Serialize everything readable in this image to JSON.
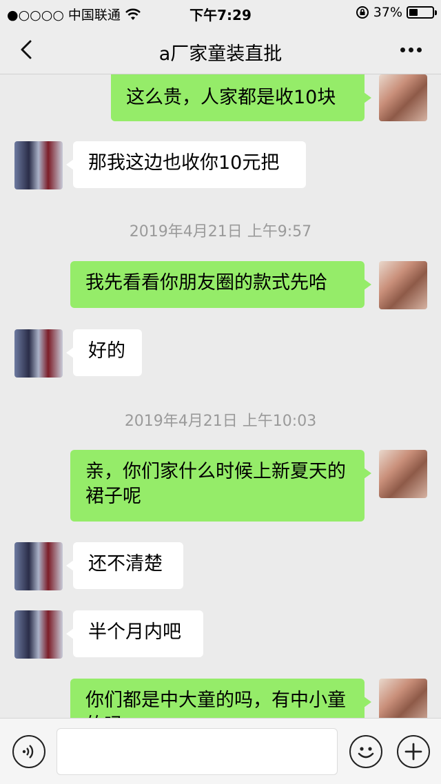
{
  "status_bar": {
    "carrier": "●○○○○ 中国联通",
    "time": "下午7:29",
    "battery": "37%",
    "battery_level": 0.37
  },
  "nav": {
    "title": "a厂家童装直批"
  },
  "messages": [
    {
      "type": "me",
      "text": "这么贵，人家都是收10块"
    },
    {
      "type": "them",
      "text": "那我这边也收你10元把"
    },
    {
      "type": "time",
      "text": "2019年4月21日 上午9:57"
    },
    {
      "type": "me",
      "text": "我先看看你朋友圈的款式先哈"
    },
    {
      "type": "them",
      "text": "好的"
    },
    {
      "type": "time",
      "text": "2019年4月21日 上午10:03"
    },
    {
      "type": "me",
      "text": "亲，你们家什么时候上新夏天的裙子呢"
    },
    {
      "type": "them",
      "text": "还不清楚"
    },
    {
      "type": "them",
      "text": "半个月内吧"
    },
    {
      "type": "me",
      "text": "你们都是中大童的吗，有中小童的吗"
    }
  ]
}
